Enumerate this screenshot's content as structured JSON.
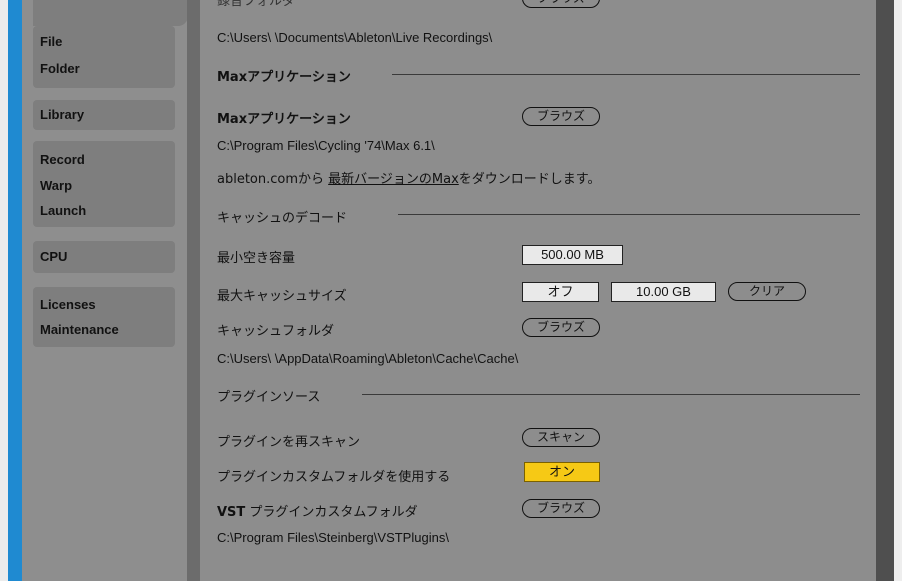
{
  "sidebar": {
    "groups": [
      {
        "items": [
          "File",
          "Folder"
        ]
      },
      {
        "items": [
          "Library"
        ]
      },
      {
        "items": [
          "Record",
          "Warp",
          "Launch"
        ]
      },
      {
        "items": [
          "CPU"
        ]
      },
      {
        "items": [
          "Licenses",
          "Maintenance"
        ]
      }
    ]
  },
  "content": {
    "top_partial_label": "録音フォルダ",
    "top_partial_button": "ブラウズ",
    "recordings_path": "C:\\Users\\     \\Documents\\Ableton\\Live Recordings\\",
    "max_section": {
      "header": "Maxアプリケーション",
      "label": "Maxアプリケーション",
      "browse": "ブラウズ",
      "path": "C:\\Program Files\\Cycling '74\\Max 6.1\\",
      "download_prefix": "ableton.comから",
      "download_link": "最新バージョンのMax",
      "download_suffix": "をダウンロードします。"
    },
    "cache_section": {
      "header": "キャッシュのデコード",
      "min_free_label": "最小空き容量",
      "min_free_value": "500.00 MB",
      "max_cache_label": "最大キャッシュサイズ",
      "max_cache_toggle": "オフ",
      "max_cache_value": "10.00 GB",
      "clear_button": "クリア",
      "folder_label": "キャッシュフォルダ",
      "folder_browse": "ブラウズ",
      "folder_path": "C:\\Users\\     \\AppData\\Roaming\\Ableton\\Cache\\Cache\\"
    },
    "plugin_section": {
      "header": "プラグインソース",
      "rescan_label": "プラグインを再スキャン",
      "rescan_button": "スキャン",
      "custom_folder_label": "プラグインカスタムフォルダを使用する",
      "custom_folder_toggle": "オン",
      "vst_label_bold": "VST",
      "vst_label_rest": " プラグインカスタムフォルダ",
      "vst_browse": "ブラウズ",
      "vst_path": "C:\\Program Files\\Steinberg\\VSTPlugins\\"
    }
  },
  "colors": {
    "accent_blue": "#1f8ad1",
    "toggle_on": "#f6c915",
    "panel": "#8d8d8d"
  }
}
